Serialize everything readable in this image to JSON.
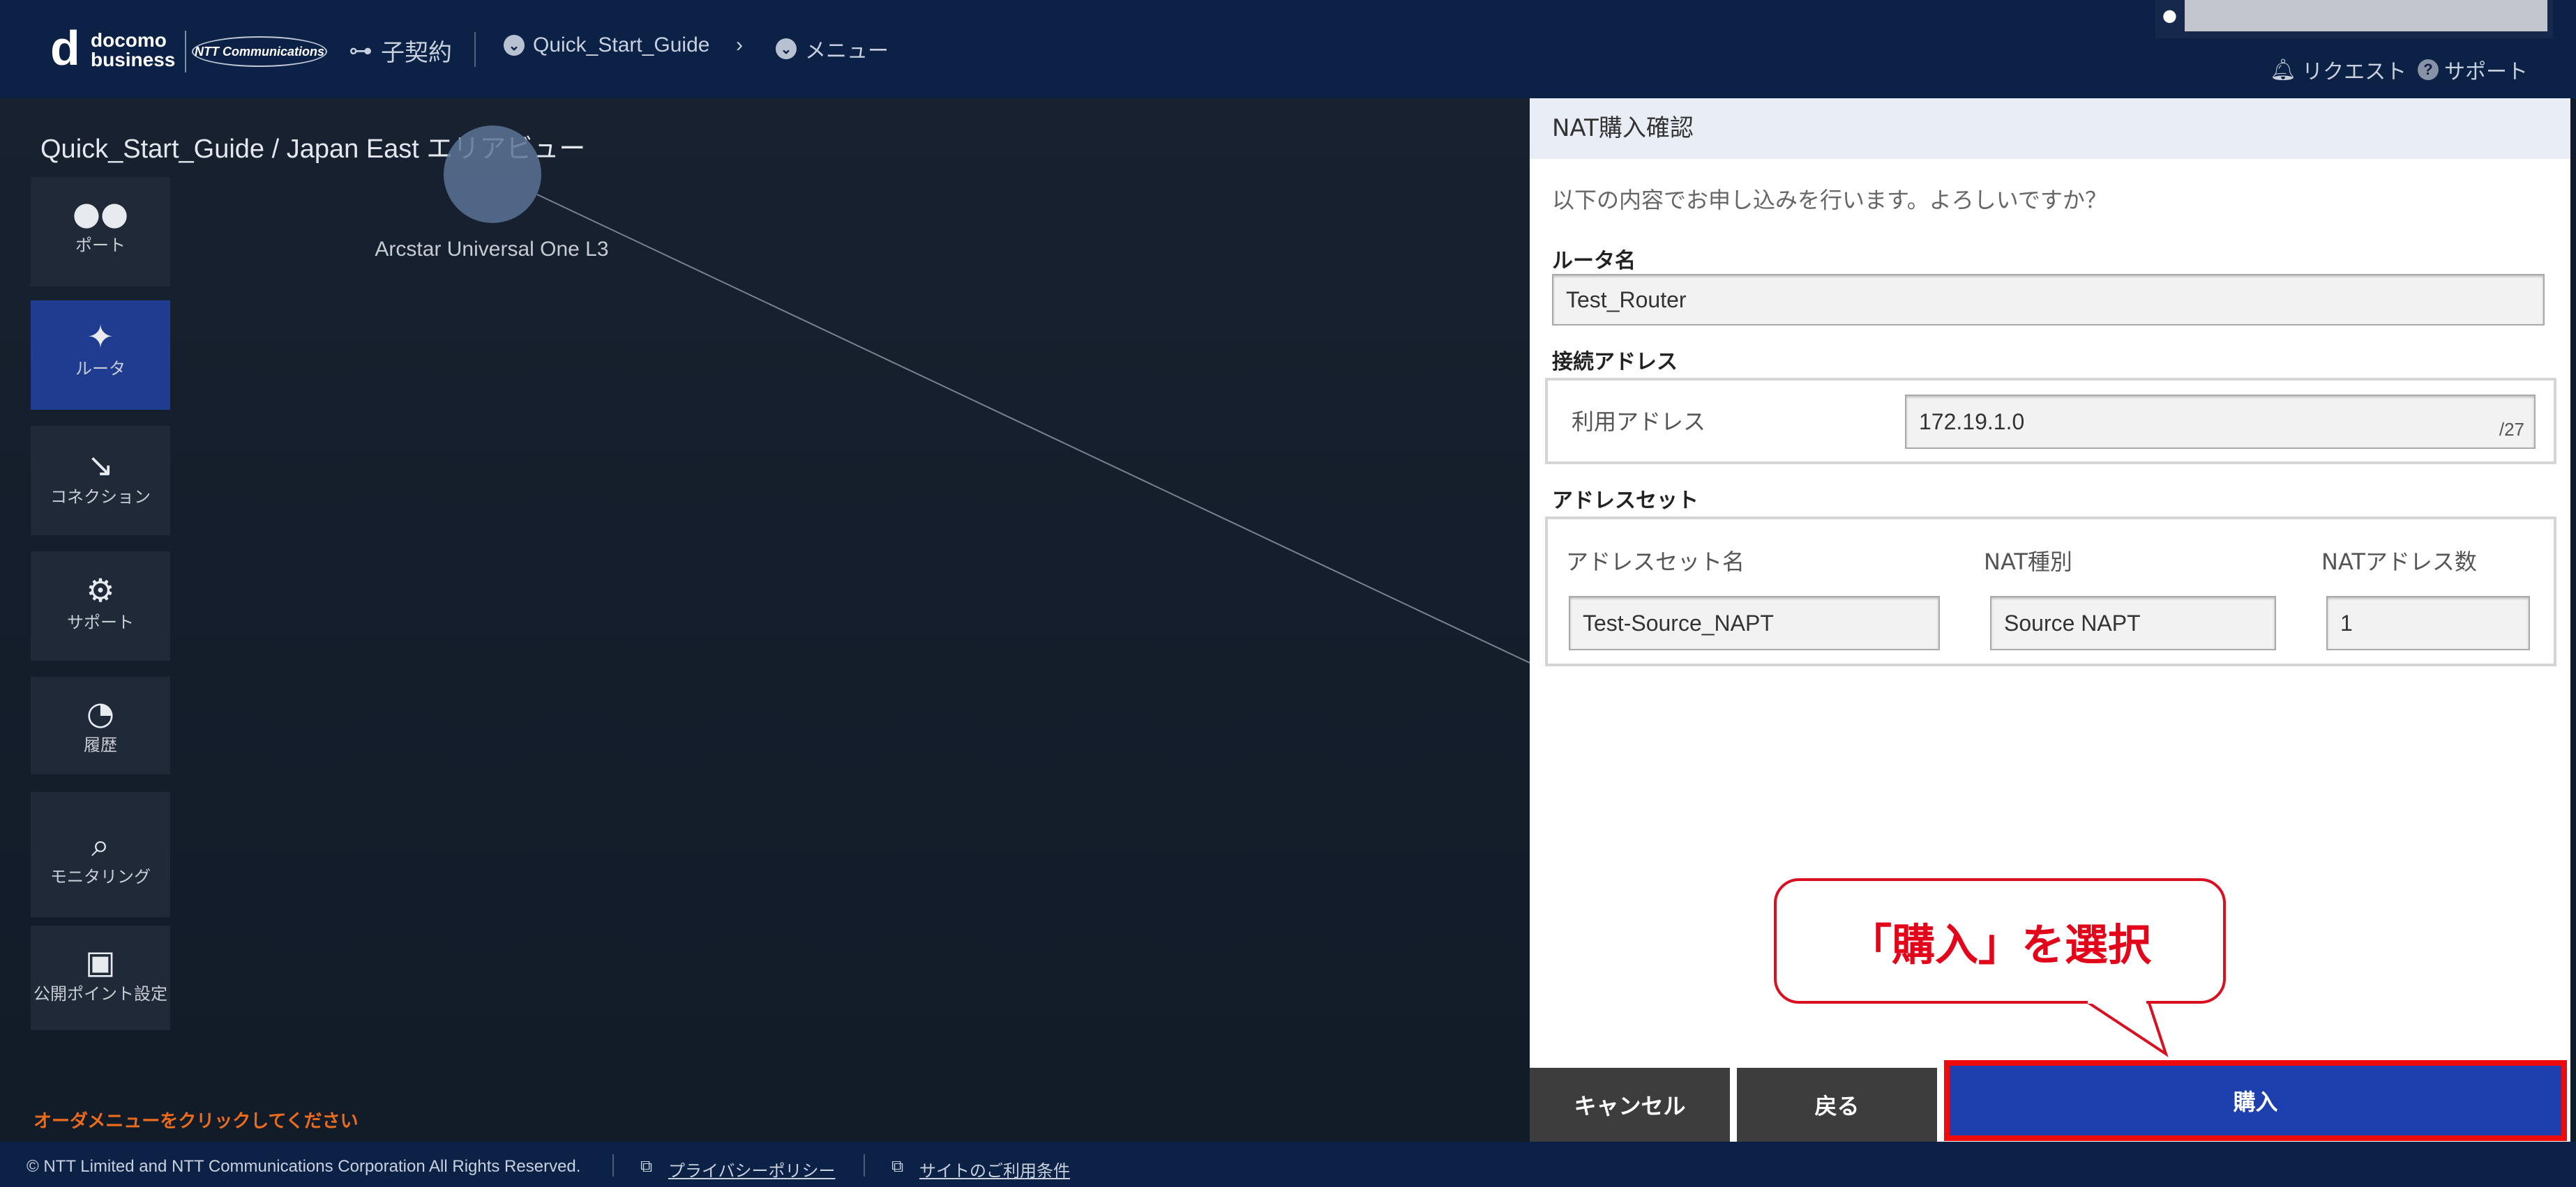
{
  "header": {
    "logo_top": "docomo",
    "logo_bottom": "business",
    "ntt_logo": "NTT Communications",
    "sub_contract": "子契約",
    "breadcrumb_guide": "Quick_Start_Guide",
    "breadcrumb_menu": "メニュー",
    "request": "リクエスト",
    "support": "サポート",
    "user_icon": "user-icon"
  },
  "map": {
    "title": "Quick_Start_Guide / Japan East エリアビュー",
    "node_label": "Arcstar Universal One L3",
    "order_hint": "オーダメニューをクリックしてください"
  },
  "sidebar": {
    "items": [
      {
        "label": "ポート",
        "icon": "port-icon"
      },
      {
        "label": "ルータ",
        "icon": "router-icon"
      },
      {
        "label": "コネクション",
        "icon": "connection-icon"
      },
      {
        "label": "サポート",
        "icon": "support-icon"
      },
      {
        "label": "履歴",
        "icon": "history-icon"
      },
      {
        "label": "モニタリング",
        "icon": "monitoring-icon"
      },
      {
        "label": "公開ポイント設定",
        "icon": "public-point-icon"
      }
    ]
  },
  "panel": {
    "title": "NAT購入確認",
    "confirm_text": "以下の内容でお申し込みを行います。よろしいですか？",
    "router_name_label": "ルータ名",
    "router_name_value": "Test_Router",
    "connection_address_label": "接続アドレス",
    "use_address_label": "利用アドレス",
    "use_address_value": "172.19.1.0",
    "use_address_suffix": "/27",
    "address_set_label": "アドレスセット",
    "address_set_name_label": "アドレスセット名",
    "nat_type_label": "NAT種別",
    "nat_count_label": "NATアドレス数",
    "address_set_name_value": "Test-Source_NAPT",
    "nat_type_value": "Source NAPT",
    "nat_count_value": "1",
    "cancel_label": "キャンセル",
    "back_label": "戻る",
    "buy_label": "購入"
  },
  "callout": {
    "text": "「購入」を選択"
  },
  "footer": {
    "copyright": "© NTT Limited and NTT Communications Corporation All Rights Reserved.",
    "privacy": "プライバシーポリシー",
    "terms": "サイトのご利用条件"
  },
  "colors": {
    "header_bg": "#0c2146",
    "active_blue": "#1f3c91",
    "buy_blue": "#1e3fae",
    "highlight_red": "#ef0b0b",
    "hint_orange": "#ec6c1c"
  }
}
